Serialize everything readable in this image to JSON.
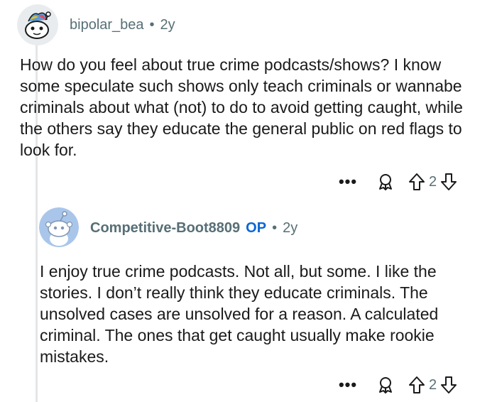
{
  "comments": [
    {
      "username": "bipolar_bea",
      "separator": "•",
      "age": "2y",
      "op_badge": "",
      "body": "How do you feel about true crime podcasts/shows? I know some speculate such shows only teach criminals or wannabe criminals about what (not) to do to avoid getting caught, while the others say they educate the general public on red flags to look for.",
      "more": "•••",
      "score": "2"
    },
    {
      "username": "Competitive-Boot8809",
      "separator": "•",
      "age": "2y",
      "op_badge": "OP",
      "body": "I enjoy true crime podcasts. Not all, but some. I like the stories. I don’t really think they educate criminals. The unsolved cases are unsolved for a reason. A calculated criminal. The ones that get caught usually make rookie mistakes.",
      "more": "•••",
      "score": "2"
    }
  ],
  "colors": {
    "op_badge": "#0a66d6",
    "meta_gray": "#576f76",
    "thread_line": "#e4e6e9"
  },
  "icons": [
    "snoo-avatar-icon",
    "more-options-icon",
    "award-icon",
    "upvote-icon",
    "downvote-icon"
  ]
}
